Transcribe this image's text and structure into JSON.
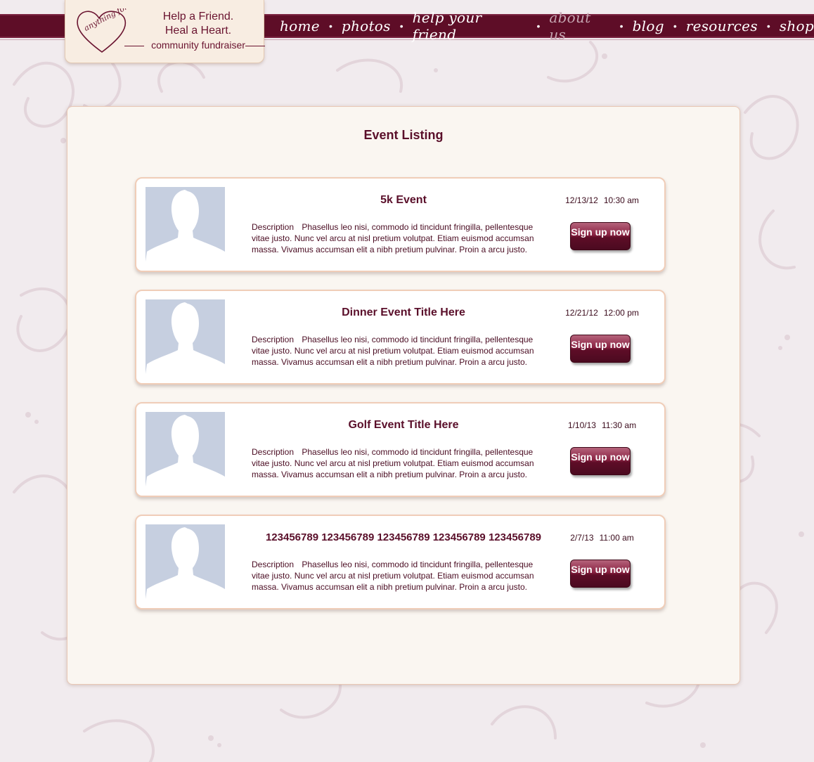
{
  "logo": {
    "text": "anything for a friend"
  },
  "tagline": {
    "line1": "Help a Friend.",
    "line2": "Heal a Heart.",
    "line3": "community fundraiser"
  },
  "nav": {
    "items": [
      "home",
      "photos",
      "help your friend",
      "about us",
      "blog",
      "resources",
      "shop"
    ],
    "active": "about us",
    "separator": "•"
  },
  "page": {
    "title": "Event Listing"
  },
  "events": [
    {
      "title": "5k Event",
      "date": "12/13/12",
      "time": "10:30 am",
      "desc_label": "Description",
      "desc": "Phasellus leo nisi, commodo id tincidunt fringilla, pellentesque vitae justo. Nunc vel arcu at nisl pretium volutpat. Etiam euismod accumsan massa. Vivamus accumsan elit a nibh pretium pulvinar. Proin a arcu justo.",
      "button": "Sign up now"
    },
    {
      "title": "Dinner Event Title Here",
      "date": "12/21/12",
      "time": "12:00 pm",
      "desc_label": "Description",
      "desc": "Phasellus leo nisi, commodo id tincidunt fringilla, pellentesque vitae justo. Nunc vel arcu at nisl pretium volutpat. Etiam euismod accumsan massa. Vivamus accumsan elit a nibh pretium pulvinar. Proin a arcu justo.",
      "button": "Sign up now"
    },
    {
      "title": "Golf Event Title Here",
      "date": "1/10/13",
      "time": "11:30 am",
      "desc_label": "Description",
      "desc": "Phasellus leo nisi, commodo id tincidunt fringilla, pellentesque vitae justo. Nunc vel arcu at nisl pretium volutpat. Etiam euismod accumsan massa. Vivamus accumsan elit a nibh pretium pulvinar. Proin a arcu justo.",
      "button": "Sign up now"
    },
    {
      "title": "123456789 123456789 123456789 123456789 123456789",
      "date": "2/7/13",
      "time": "11:00 am",
      "desc_label": "Description",
      "desc": "Phasellus leo nisi, commodo id tincidunt fringilla, pellentesque vitae justo. Nunc vel arcu at nisl pretium volutpat. Etiam euismod accumsan massa. Vivamus accumsan elit a nibh pretium pulvinar. Proin a arcu justo.",
      "button": "Sign up now"
    }
  ],
  "colors": {
    "brand": "#5e0d27",
    "background": "#f1ebee",
    "panel": "#faf6f1",
    "photo_placeholder": "#c6cfe0"
  },
  "icons": {
    "logo": "heart-logo-icon",
    "photo": "person-silhouette-icon"
  }
}
